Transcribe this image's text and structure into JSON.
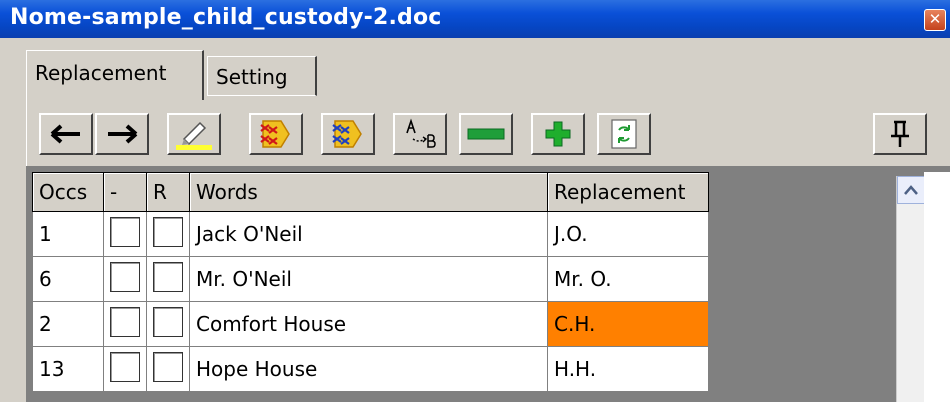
{
  "window": {
    "title": "Nome-sample_child_custody-2.doc",
    "close_glyph": "✕"
  },
  "tabs": [
    {
      "label": "Replacement"
    },
    {
      "label": "Setting"
    }
  ],
  "toolbar": {
    "buttons": [
      {
        "icon": "arrow-left-icon"
      },
      {
        "icon": "arrow-right-icon"
      },
      {
        "icon": "highlight-pen-icon"
      },
      {
        "icon": "red-wordlist-icon"
      },
      {
        "icon": "blue-wordlist-icon"
      },
      {
        "icon": "ab-replace-icon"
      },
      {
        "icon": "minus-icon"
      },
      {
        "icon": "plus-icon"
      },
      {
        "icon": "refresh-icon"
      },
      {
        "icon": "pin-icon"
      }
    ],
    "colors": {
      "minus": "#1f9e3a",
      "plus": "#1fae2d",
      "highlight_bar": "#ffff33"
    }
  },
  "grid": {
    "headers": [
      "Occs",
      "-",
      "R",
      "Words",
      "Replacement"
    ],
    "rows": [
      {
        "occs": "1",
        "word": "Jack O'Neil",
        "replacement": "J.O."
      },
      {
        "occs": "6",
        "word": "Mr. O'Neil",
        "replacement": "Mr. O."
      },
      {
        "occs": "2",
        "word": "Comfort House",
        "replacement": "C.H.",
        "highlight": "#ff8000"
      },
      {
        "occs": "13",
        "word": "Hope House",
        "replacement": "H.H."
      }
    ]
  }
}
